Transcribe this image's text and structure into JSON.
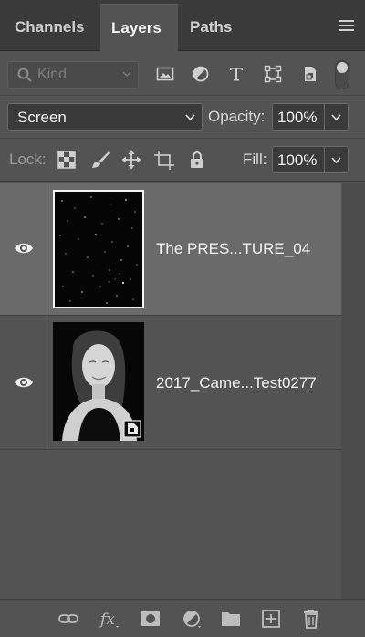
{
  "tabs": [
    {
      "label": "Channels",
      "active": false
    },
    {
      "label": "Layers",
      "active": true
    },
    {
      "label": "Paths",
      "active": false
    }
  ],
  "panel_menu_icon": "hamburger-icon",
  "filter": {
    "kind_placeholder": "Kind",
    "filter_icons": [
      "image-filter-icon",
      "adjustment-filter-icon",
      "type-filter-icon",
      "shape-filter-icon",
      "smart-object-filter-icon"
    ],
    "filter_toggle_on": true
  },
  "blend": {
    "mode": "Screen",
    "opacity_label": "Opacity:",
    "opacity_value": "100%"
  },
  "lock": {
    "label": "Lock:",
    "icons": [
      "lock-transparent-pixels-icon",
      "lock-image-pixels-icon",
      "lock-position-icon",
      "lock-artboard-icon",
      "lock-all-icon"
    ],
    "fill_label": "Fill:",
    "fill_value": "100%"
  },
  "layers": [
    {
      "name": "The PRES...TURE_04",
      "visible": true,
      "selected": true,
      "thumbnail": "black-with-white-specks-texture"
    },
    {
      "name": "2017_Came...Test0277",
      "visible": true,
      "selected": false,
      "thumbnail": "black-and-white-portrait-of-woman",
      "smart_object": true
    }
  ],
  "bottom_icons": [
    "link-layers-icon",
    "fx-icon",
    "add-mask-icon",
    "adjustment-layer-icon",
    "new-group-icon",
    "new-layer-icon",
    "delete-layer-icon"
  ],
  "colors": {
    "panel_bg": "#535353",
    "tabbar_bg": "#3a3a3a",
    "selected_layer_bg": "#6a6a6a",
    "field_bg": "#3a3a3a"
  }
}
